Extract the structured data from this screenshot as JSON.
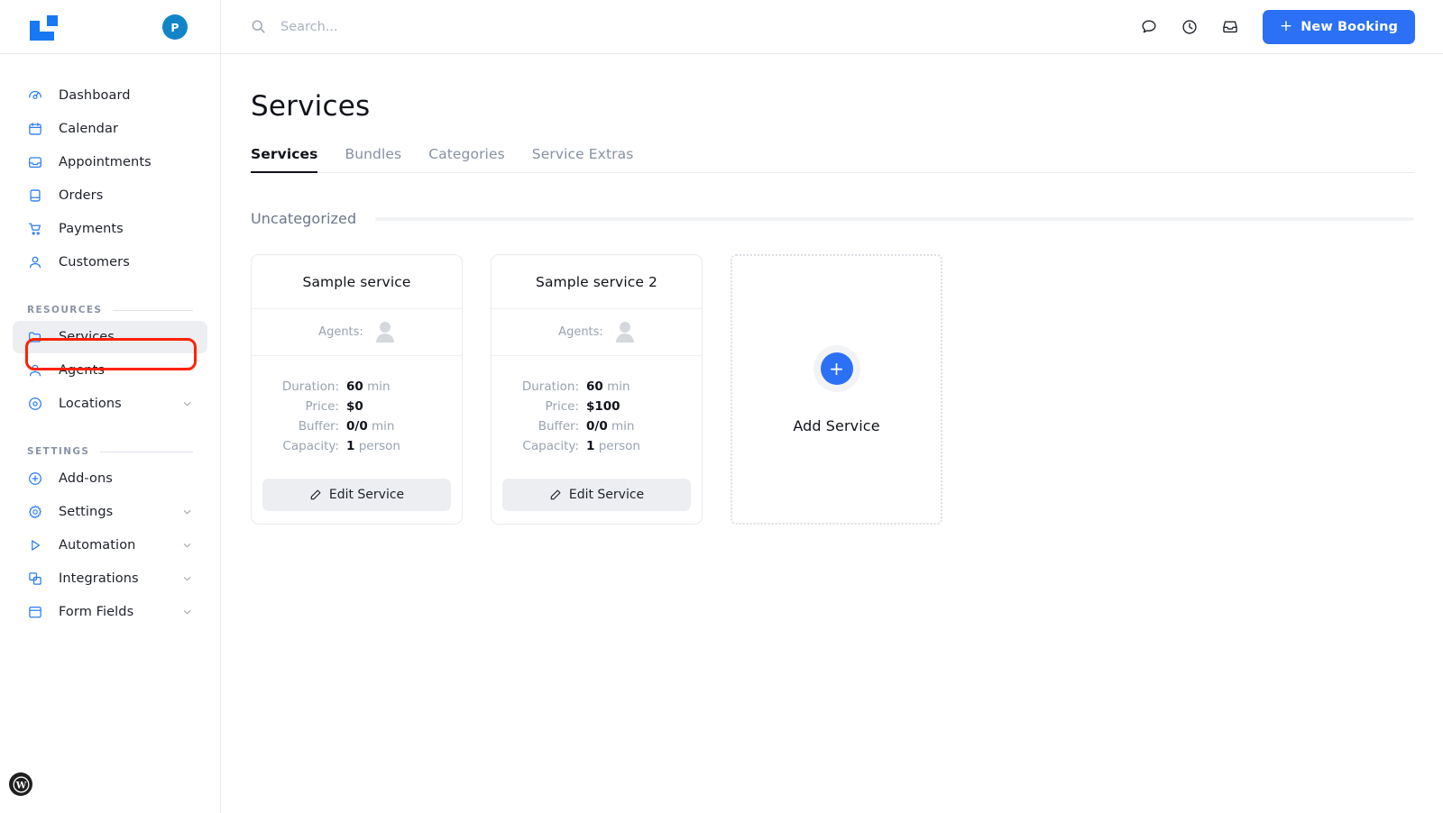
{
  "brand": {
    "logo_icon": "logo-mark",
    "accent_blue": "#2b70f5",
    "avatar_initial": "P",
    "avatar_color": "#1285c8",
    "highlight_color": "#ff2200"
  },
  "topbar": {
    "search_placeholder": "Search...",
    "search_value": "",
    "icons": [
      {
        "name": "chat-icon"
      },
      {
        "name": "clock-icon"
      },
      {
        "name": "inbox-icon"
      }
    ],
    "new_booking_plus": "+",
    "new_booking_label": "New Booking"
  },
  "sidebar": {
    "primary_items": [
      {
        "label": "Dashboard",
        "icon": "gauge-icon",
        "active": false,
        "expandable": false
      },
      {
        "label": "Calendar",
        "icon": "calendar-icon",
        "active": false,
        "expandable": false
      },
      {
        "label": "Appointments",
        "icon": "inbox-tray-icon",
        "active": false,
        "expandable": false
      },
      {
        "label": "Orders",
        "icon": "book-icon",
        "active": false,
        "expandable": false
      },
      {
        "label": "Payments",
        "icon": "cart-icon",
        "active": false,
        "expandable": false
      },
      {
        "label": "Customers",
        "icon": "person-icon",
        "active": false,
        "expandable": false
      }
    ],
    "resources_label": "RESOURCES",
    "resources_items": [
      {
        "label": "Services",
        "icon": "folder-icon",
        "active": true,
        "expandable": false
      },
      {
        "label": "Agents",
        "icon": "person-icon",
        "active": false,
        "expandable": false
      },
      {
        "label": "Locations",
        "icon": "pin-icon",
        "active": false,
        "expandable": true
      }
    ],
    "settings_label": "SETTINGS",
    "settings_items": [
      {
        "label": "Add-ons",
        "icon": "plus-circle-icon",
        "active": false,
        "expandable": false
      },
      {
        "label": "Settings",
        "icon": "gear-icon",
        "active": false,
        "expandable": true
      },
      {
        "label": "Automation",
        "icon": "play-icon",
        "active": false,
        "expandable": true
      },
      {
        "label": "Integrations",
        "icon": "layers-icon",
        "active": false,
        "expandable": true
      },
      {
        "label": "Form Fields",
        "icon": "form-icon",
        "active": false,
        "expandable": true
      }
    ],
    "footer_badge": "wordpress-icon"
  },
  "main": {
    "page_title": "Services",
    "tabs": [
      {
        "label": "Services",
        "active": true
      },
      {
        "label": "Bundles",
        "active": false
      },
      {
        "label": "Categories",
        "active": false
      },
      {
        "label": "Service Extras",
        "active": false
      }
    ],
    "category_name": "Uncategorized",
    "cards": [
      {
        "title": "Sample service",
        "agents_label": "Agents:",
        "specs": [
          {
            "key": "Duration:",
            "value": "60",
            "unit": " min"
          },
          {
            "key": "Price:",
            "value": "$0",
            "unit": ""
          },
          {
            "key": "Buffer:",
            "value": "0/0",
            "unit": " min"
          },
          {
            "key": "Capacity:",
            "value": "1",
            "unit": " person"
          }
        ],
        "edit_label": "Edit Service"
      },
      {
        "title": "Sample service 2",
        "agents_label": "Agents:",
        "specs": [
          {
            "key": "Duration:",
            "value": "60",
            "unit": " min"
          },
          {
            "key": "Price:",
            "value": "$100",
            "unit": ""
          },
          {
            "key": "Buffer:",
            "value": "0/0",
            "unit": " min"
          },
          {
            "key": "Capacity:",
            "value": "1",
            "unit": " person"
          }
        ],
        "edit_label": "Edit Service"
      }
    ],
    "add_card": {
      "plus": "+",
      "label": "Add Service"
    }
  }
}
